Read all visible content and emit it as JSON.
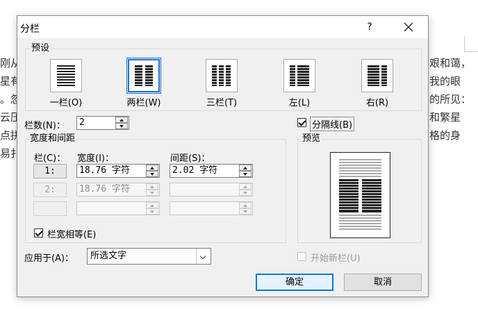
{
  "background_doc": {
    "left_lines": [
      "刚从",
      "星有",
      "。忽",
      "云压",
      "点拼",
      "易扌"
    ],
    "right_lines": [
      "艰和蔼，",
      "我的眼",
      "的所见：",
      "和繁星",
      "格的身",
      ""
    ]
  },
  "dialog": {
    "title": "分栏",
    "help_label": "?",
    "presets": {
      "legend": "预设",
      "items": [
        {
          "label": "一栏(O)",
          "columns": 1,
          "selected": false
        },
        {
          "label": "两栏(W)",
          "columns": 2,
          "selected": true
        },
        {
          "label": "三栏(T)",
          "columns": 3,
          "selected": false
        },
        {
          "label": "左(L)",
          "columns": "left",
          "selected": false
        },
        {
          "label": "右(R)",
          "columns": "right",
          "selected": false
        }
      ]
    },
    "num_columns": {
      "label": "栏数(N)：",
      "value": "2"
    },
    "separator": {
      "label": "分隔线(B)",
      "checked": true
    },
    "width_spacing": {
      "legend": "宽度和间距",
      "col_header": "栏(C)：",
      "width_header": "宽度(I)：",
      "spacing_header": "间距(S)：",
      "rows": [
        {
          "col": "1:",
          "width": "18.76 字符",
          "spacing": "2.02 字符",
          "enabled": true
        },
        {
          "col": "2:",
          "width": "18.76 字符",
          "spacing": "",
          "enabled": false
        },
        {
          "col": "",
          "width": "",
          "spacing": "",
          "enabled": false
        }
      ]
    },
    "equal_width": {
      "label": "栏宽相等(E)",
      "checked": true
    },
    "preview": {
      "legend": "预览"
    },
    "apply_to": {
      "label": "应用于(A)：",
      "value": "所选文字"
    },
    "new_column": {
      "label": "开始新栏(U)",
      "checked": false
    },
    "ok_label": "确定",
    "cancel_label": "取消"
  },
  "colors": {
    "accent": "#0078d7",
    "selection_border": "#1a6fd1"
  }
}
